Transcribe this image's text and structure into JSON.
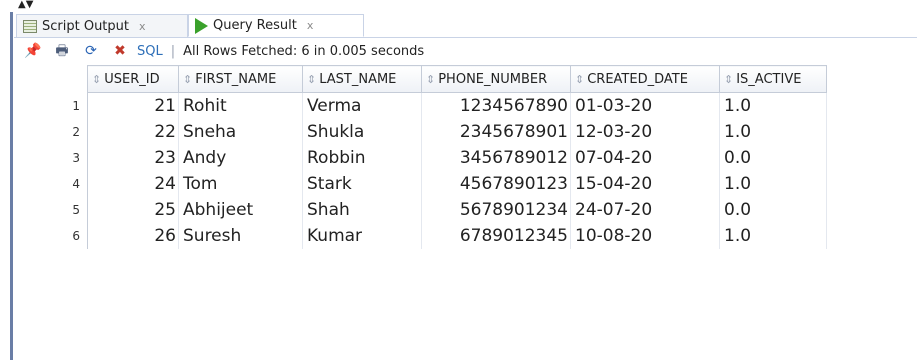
{
  "tabs": [
    {
      "label": "Script Output",
      "close": "x",
      "icon": "script-icon"
    },
    {
      "label": "Query Result",
      "close": "x",
      "icon": "play-icon"
    }
  ],
  "toolbar": {
    "sql_label": "SQL",
    "separator": "|",
    "status": "All Rows Fetched: 6 in 0.005 seconds"
  },
  "grid": {
    "columns": [
      "USER_ID",
      "FIRST_NAME",
      "LAST_NAME",
      "PHONE_NUMBER",
      "CREATED_DATE",
      "IS_ACTIVE"
    ],
    "rows": [
      {
        "n": "1",
        "user_id": "21",
        "first_name": "Rohit",
        "last_name": "Verma",
        "phone": "1234567890",
        "created": "01-03-20",
        "active": "1.0"
      },
      {
        "n": "2",
        "user_id": "22",
        "first_name": "Sneha",
        "last_name": "Shukla",
        "phone": "2345678901",
        "created": "12-03-20",
        "active": "1.0"
      },
      {
        "n": "3",
        "user_id": "23",
        "first_name": "Andy",
        "last_name": "Robbin",
        "phone": "3456789012",
        "created": "07-04-20",
        "active": "0.0"
      },
      {
        "n": "4",
        "user_id": "24",
        "first_name": "Tom",
        "last_name": "Stark",
        "phone": "4567890123",
        "created": "15-04-20",
        "active": "1.0"
      },
      {
        "n": "5",
        "user_id": "25",
        "first_name": "Abhijeet",
        "last_name": "Shah",
        "phone": "5678901234",
        "created": "24-07-20",
        "active": "0.0"
      },
      {
        "n": "6",
        "user_id": "26",
        "first_name": "Suresh",
        "last_name": "Kumar",
        "phone": "6789012345",
        "created": "10-08-20",
        "active": "1.0"
      }
    ]
  },
  "colors": {
    "accent_link": "#2e6fb8",
    "run_green": "#3aa12b",
    "grid_border": "#c5ccd8"
  }
}
